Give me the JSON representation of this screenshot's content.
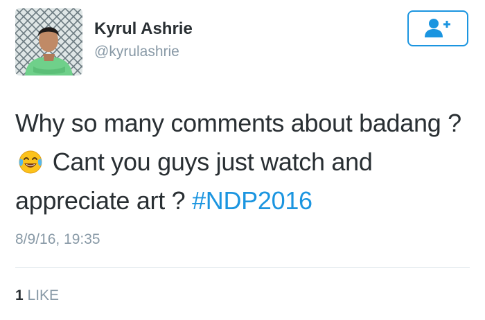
{
  "author": {
    "name": "Kyrul Ashrie",
    "handle": "@kyrulashrie",
    "avatar_icon": "profile-photo"
  },
  "follow_button": {
    "icon": "add-user-icon",
    "color": "#1b95e0"
  },
  "tweet": {
    "text_part1": "Why so many comments about badang ?",
    "emoji": "face-with-tears-of-joy",
    "text_part2": "Cant you guys just watch and appreciate art ?",
    "hashtag": "#NDP2016",
    "timestamp": "8/9/16, 19:35"
  },
  "stats": {
    "like_count": "1",
    "like_label": "LIKE"
  },
  "colors": {
    "text": "#292f33",
    "secondary": "#8899a6",
    "link": "#1b95e0",
    "divider": "#e1e8ed"
  }
}
